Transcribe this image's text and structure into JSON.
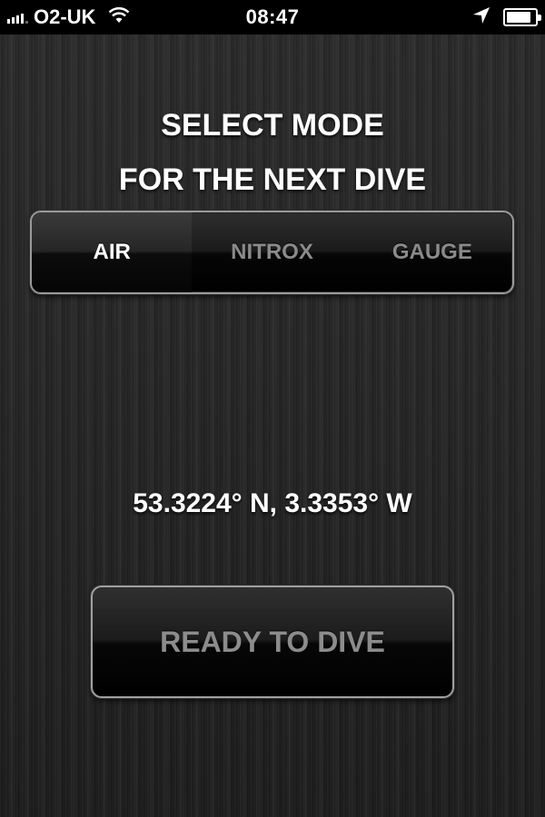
{
  "status_bar": {
    "carrier": "O2-UK",
    "time": "08:47",
    "icons": [
      "signal-icon",
      "wifi-icon",
      "location-arrow-icon",
      "battery-icon"
    ],
    "battery_level": 0.85
  },
  "title": {
    "line1": "SELECT MODE",
    "line2": "FOR THE NEXT DIVE"
  },
  "mode_selector": {
    "selected": "AIR",
    "options": [
      {
        "label": "AIR"
      },
      {
        "label": "NITROX"
      },
      {
        "label": "GAUGE"
      }
    ]
  },
  "location": {
    "coordinates": "53.3224° N, 3.3353° W"
  },
  "ready_button": {
    "label": "READY TO DIVE"
  },
  "colors": {
    "selected_text": "#ffffff",
    "unselected_text": "#8a8a8a",
    "button_border": "#a0a0a0"
  }
}
